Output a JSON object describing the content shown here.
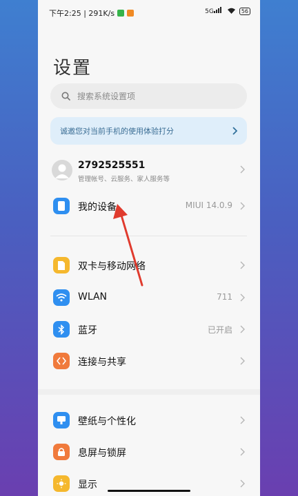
{
  "status_bar": {
    "time_speed": "下午2:25 | 291K/s",
    "signal": "5G",
    "battery": "56"
  },
  "page": {
    "title": "设置"
  },
  "search": {
    "placeholder": "搜索系统设置项"
  },
  "banner": {
    "text": "诚邀您对当前手机的使用体验打分"
  },
  "account": {
    "name": "2792525551",
    "subtitle": "管理帐号、云服务、家人服务等"
  },
  "rows": {
    "my_device": {
      "label": "我的设备",
      "value": "MIUI 14.0.9",
      "icon": "phone-icon",
      "color": "#2f8ff0"
    },
    "sim": {
      "label": "双卡与移动网络",
      "icon": "sim-card-icon",
      "color": "#f5b82e"
    },
    "wlan": {
      "label": "WLAN",
      "value": "711",
      "icon": "wifi-icon",
      "color": "#2f8ff0"
    },
    "bluetooth": {
      "label": "蓝牙",
      "value": "已开启",
      "icon": "bluetooth-icon",
      "color": "#2f8ff0"
    },
    "connect": {
      "label": "连接与共享",
      "icon": "share-icon",
      "color": "#f07a3c"
    },
    "wallpaper": {
      "label": "壁纸与个性化",
      "icon": "wallpaper-icon",
      "color": "#2f8ff0"
    },
    "lockscreen": {
      "label": "息屏与锁屏",
      "icon": "lock-icon",
      "color": "#f07a3c"
    },
    "display": {
      "label": "显示",
      "icon": "sun-icon",
      "color": "#f5b82e"
    }
  },
  "colors": {
    "annotation_arrow": "#e03b2e"
  }
}
